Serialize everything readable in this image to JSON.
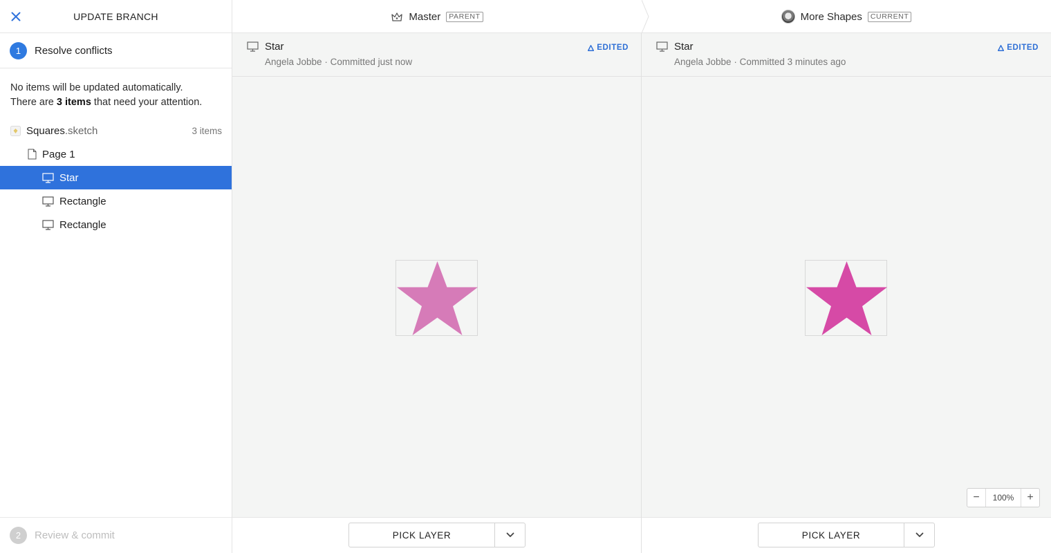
{
  "sidebar": {
    "title": "UPDATE BRANCH",
    "step1": {
      "number": "1",
      "label": "Resolve conflicts"
    },
    "notice": {
      "line1": "No items will be updated automatically.",
      "line2_pre": "There are ",
      "line2_bold": "3 items",
      "line2_post": " that need your attention."
    },
    "tree": {
      "file": {
        "name": "Squares",
        "ext": ".sketch",
        "count": "3 items"
      },
      "page": {
        "name": "Page 1"
      },
      "layers": [
        {
          "name": "Star",
          "selected": true
        },
        {
          "name": "Rectangle",
          "selected": false
        },
        {
          "name": "Rectangle",
          "selected": false
        }
      ]
    },
    "step2": {
      "number": "2",
      "label": "Review & commit"
    }
  },
  "topbar": {
    "left": {
      "branch": "Master",
      "tag": "PARENT"
    },
    "right": {
      "branch": "More Shapes",
      "tag": "CURRENT"
    }
  },
  "panels": {
    "left": {
      "title": "Star",
      "author": "Angela Jobbe",
      "separator": " · ",
      "commit": "Committed just now",
      "status": "EDITED",
      "star_color": "#d67bb8"
    },
    "right": {
      "title": "Star",
      "author": "Angela Jobbe",
      "separator": " · ",
      "commit": "Committed 3 minutes ago",
      "status": "EDITED",
      "star_color": "#d64aa6"
    }
  },
  "zoom": {
    "minus": "−",
    "value": "100%",
    "plus": "+"
  },
  "footer": {
    "pick_label": "PICK LAYER"
  },
  "colors": {
    "accent": "#2f72dc",
    "edited": "#2e6fd6"
  }
}
